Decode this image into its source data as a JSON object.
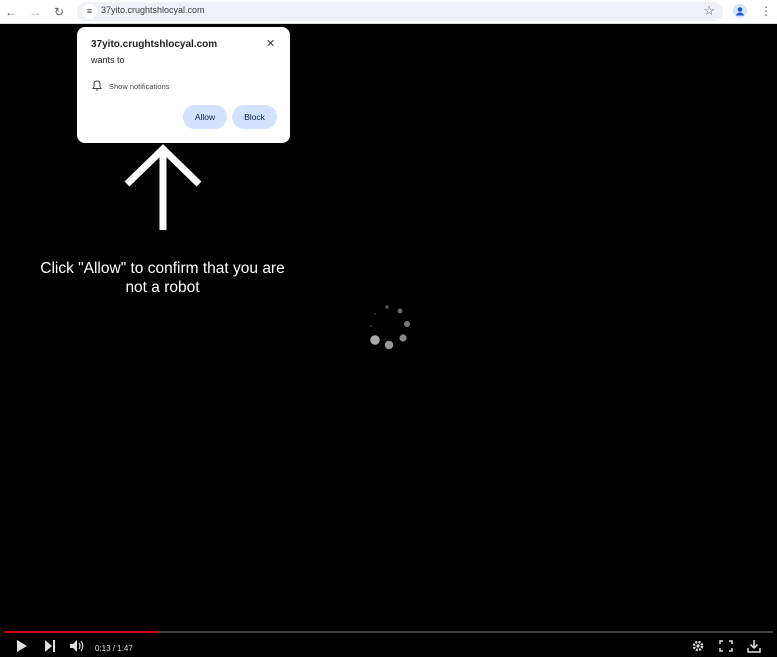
{
  "browser": {
    "url": "37yito.crughtshlocyal.com",
    "icons": [
      "back-icon",
      "forward-icon",
      "reload-icon",
      "site-info-icon",
      "bookmark-star-icon",
      "profile-icon",
      "menu-icon"
    ]
  },
  "permission_popup": {
    "host": "37yito.crughtshlocyal.com",
    "wants_to": "wants to",
    "permission": "Show notifications",
    "allow_label": "Allow",
    "block_label": "Block",
    "close_glyph": "✕"
  },
  "page": {
    "instruction": "Click \"Allow\" to confirm that you are not a robot",
    "accent_color": "#d3e3fd"
  },
  "player": {
    "time": "0:13 / 1:47",
    "progress": 0.2,
    "progress_color": "#cc0000"
  }
}
